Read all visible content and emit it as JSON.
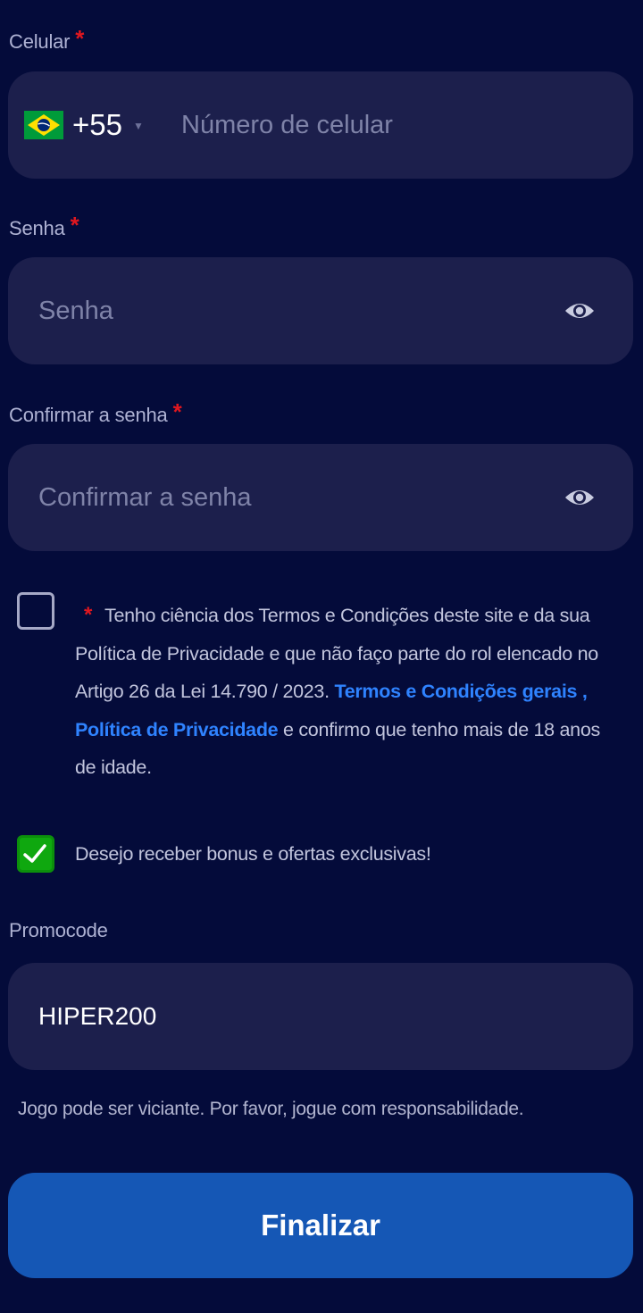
{
  "phone": {
    "label": "Celular",
    "required_mark": "*",
    "dial_code": "+55",
    "placeholder": "Número de celular",
    "flag_icon": "brazil-flag-icon"
  },
  "password": {
    "label": "Senha",
    "required_mark": "*",
    "placeholder": "Senha",
    "toggle_icon": "eye-icon"
  },
  "confirm_password": {
    "label": "Confirmar a senha",
    "required_mark": "*",
    "placeholder": "Confirmar a senha",
    "toggle_icon": "eye-icon"
  },
  "terms": {
    "checked": false,
    "required_mark": "*",
    "text_before": "Tenho ciência dos Termos e Condições deste site e da sua Política de Privacidade e que não faço parte do rol elencado no Artigo 26 da Lei 14.790 / 2023.",
    "link_terms": "Termos e Condições gerais",
    "separator": ",",
    "link_privacy": "Política de Privacidade",
    "text_after": "e confirmo que tenho mais de 18 anos de idade."
  },
  "marketing_optin": {
    "checked": true,
    "label": "Desejo receber bonus e ofertas exclusivas!"
  },
  "promocode": {
    "label": "Promocode",
    "value": "HIPER200"
  },
  "responsible_gaming_text": "Jogo pode ser viciante. Por favor, jogue com responsabilidade.",
  "submit_label": "Finalizar",
  "colors": {
    "background": "#040b3a",
    "field_bg": "#1c1f4c",
    "required": "#e0171f",
    "link": "#2f83ff",
    "checkbox_checked": "#0fa80f",
    "button": "#1557b5"
  }
}
